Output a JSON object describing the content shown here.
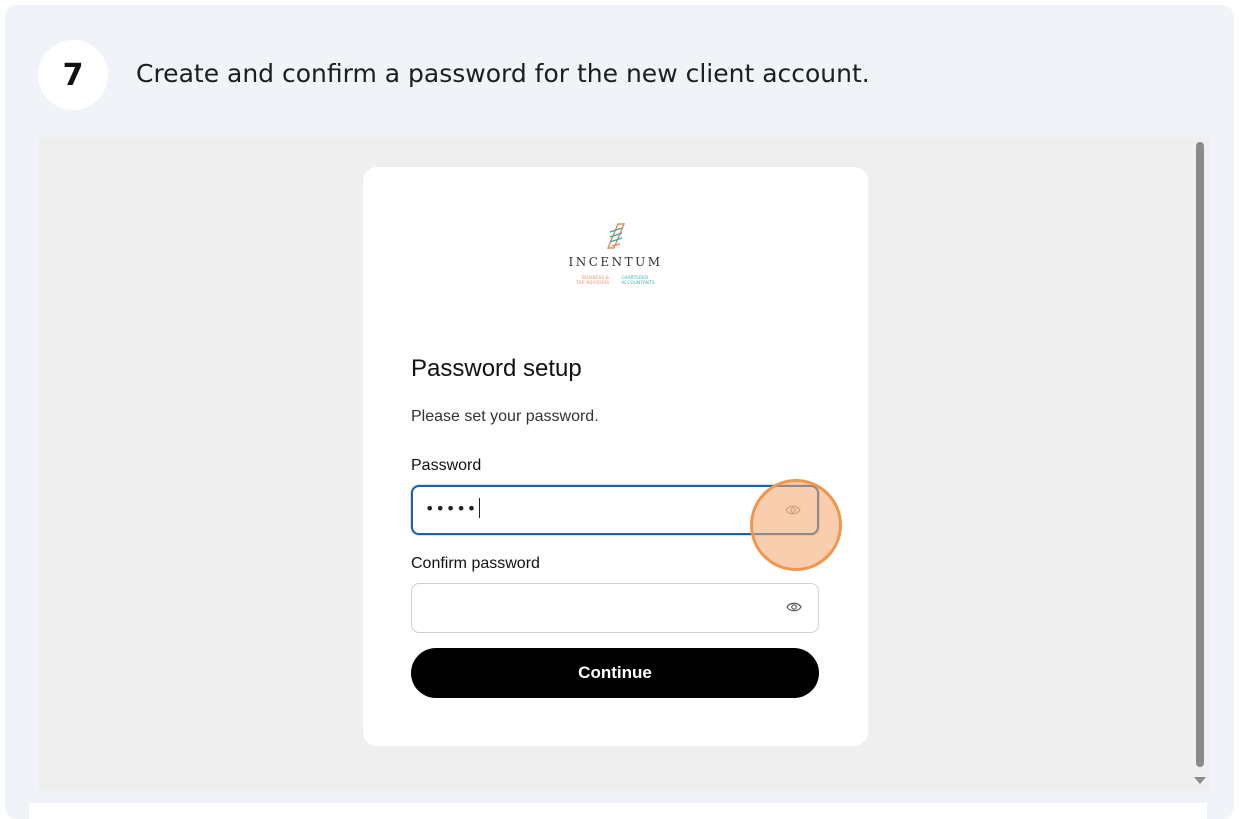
{
  "step": {
    "number": "7",
    "instruction": "Create and confirm a password for the new client account."
  },
  "logo": {
    "name": "INCENTUM",
    "sub_left_1": "BUSINESS &",
    "sub_left_2": "TAX ADVISORS",
    "sub_right_1": "CHARTERED",
    "sub_right_2": "ACCOUNTANTS"
  },
  "form": {
    "title": "Password setup",
    "subtitle": "Please set your password.",
    "password_label": "Password",
    "password_value": "•••••",
    "confirm_label": "Confirm password",
    "confirm_value": "",
    "continue_label": "Continue"
  },
  "colors": {
    "accent_focus": "#1f5fa8",
    "highlight": "#f2954d",
    "button": "#000000"
  },
  "icons": {
    "password_toggle": "eye-icon",
    "confirm_toggle": "eye-icon"
  }
}
